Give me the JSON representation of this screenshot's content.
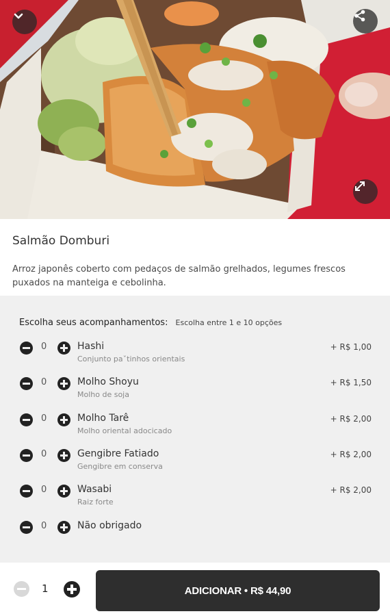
{
  "icons": {
    "collapse": "chevron-down-icon",
    "share": "share-icon",
    "expand": "expand-icon"
  },
  "product": {
    "title": "Salmão Domburi",
    "description": "Arroz japonês coberto com pedaços de salmão grelhados, legumes frescos puxados na manteiga e cebolinha."
  },
  "options": {
    "heading": "Escolha seus acompanhamentos:",
    "subheading": "Escolha entre 1 e 10 opções",
    "items": [
      {
        "qty": "0",
        "name": "Hashi",
        "note": "Conjunto pa‍ˇtinhos orientais",
        "price": "+ R$ 1,00"
      },
      {
        "qty": "0",
        "name": "Molho Shoyu",
        "note": "Molho de soja",
        "price": "+ R$ 1,50"
      },
      {
        "qty": "0",
        "name": "Molho Tarê",
        "note": "Molho oriental adocicado",
        "price": "+ R$ 2,00"
      },
      {
        "qty": "0",
        "name": "Gengibre Fatiado",
        "note": "Gengibre em conserva",
        "price": "+ R$ 2,00"
      },
      {
        "qty": "0",
        "name": "Wasabi",
        "note": "Raiz forte",
        "price": "+ R$ 2,00"
      },
      {
        "qty": "0",
        "name": "Não obrigado",
        "note": "",
        "price": ""
      }
    ]
  },
  "cart": {
    "qty": "1",
    "add_label": "ADICIONAR • R$ 44,90"
  }
}
